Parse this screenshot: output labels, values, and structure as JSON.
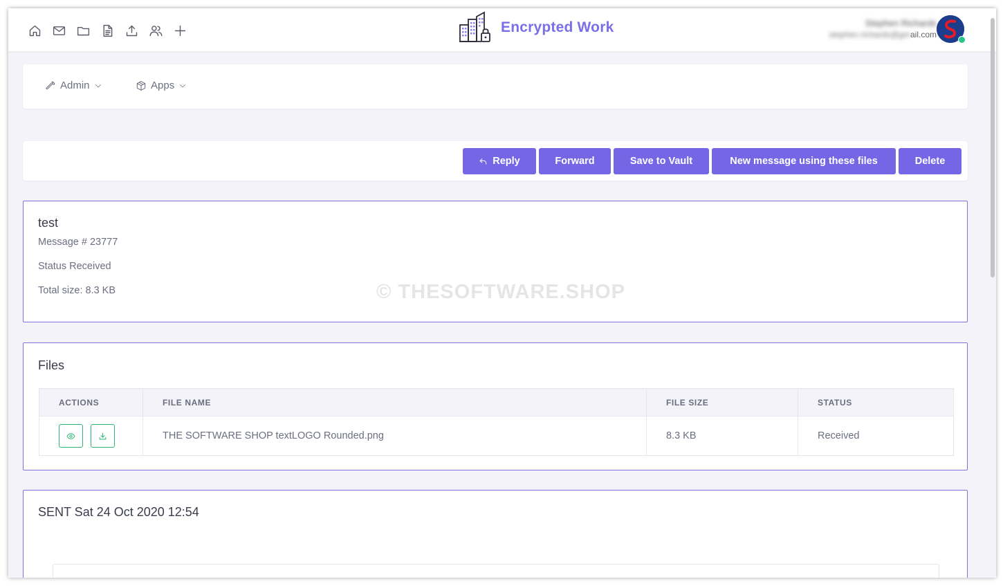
{
  "header": {
    "brand_title": "Encrypted Work",
    "user_name": "Stephen Richards",
    "user_email_hidden": "stephen.richards@gm",
    "user_email_visible": "ail.com",
    "nav_icons": [
      "home-icon",
      "mail-icon",
      "folder-icon",
      "document-icon",
      "upload-icon",
      "users-icon",
      "plus-icon"
    ],
    "accent_color": "#7b6ee8"
  },
  "menu": {
    "items": [
      {
        "label": "Admin",
        "icon": "wrench-icon"
      },
      {
        "label": "Apps",
        "icon": "box-icon"
      }
    ]
  },
  "toolbar": {
    "reply": "Reply",
    "forward": "Forward",
    "save_vault": "Save to Vault",
    "new_message": "New message using these files",
    "delete": "Delete",
    "button_color": "#7566e6"
  },
  "message": {
    "title": "test",
    "number": "Message # 23777",
    "status": "Status Received",
    "total_size": "Total size: 8.3 KB",
    "watermark": "© THESOFTWARE.SHOP"
  },
  "files": {
    "title": "Files",
    "columns": [
      "ACTIONS",
      "FILE NAME",
      "FILE SIZE",
      "STATUS"
    ],
    "rows": [
      {
        "file_name": "THE SOFTWARE SHOP textLOGO Rounded.png",
        "file_size": "8.3 KB",
        "status": "Received"
      }
    ],
    "action_color": "#2bb673"
  },
  "sent": {
    "title": "SENT Sat 24 Oct 2020 12:54"
  }
}
